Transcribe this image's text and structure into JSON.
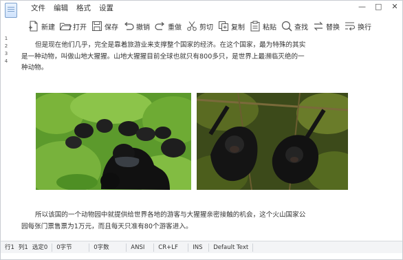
{
  "menu": {
    "items": [
      "文件",
      "编辑",
      "格式",
      "设置"
    ]
  },
  "window": {
    "min": "—",
    "max": "□",
    "close": "✕"
  },
  "toolbar": {
    "new": "新建",
    "open": "打开",
    "save": "保存",
    "undo": "撤销",
    "redo": "重做",
    "cut": "剪切",
    "copy": "复制",
    "paste": "粘贴",
    "find": "查找",
    "replace": "替换",
    "wrap": "换行"
  },
  "gutter": {
    "lines": [
      "1",
      "2",
      "3",
      "4"
    ]
  },
  "document": {
    "para1": "但是现在他们几乎，完全是靠着旅游业来支撑整个国家的经济。在这个国家，最为特殊的其实是一种动物，叫做山地大猩猩。山地大猩猩目前全球也就只有800多只，是世界上最濒临灭绝的一种动物。",
    "para2": "所以该国的一个动物园中就提供给世界各地的游客与大猩猩亲密接触的机会，这个火山国家公园每张门票售票为1万元，而且每天只准有80个游客进入。"
  },
  "status": {
    "line": "行1",
    "col": "列1",
    "sel": "选定0",
    "bytes": "0字节",
    "chars": "0字数",
    "encoding": "ANSI",
    "eol": "CR+LF",
    "mode": "INS",
    "style": "Default Text"
  }
}
